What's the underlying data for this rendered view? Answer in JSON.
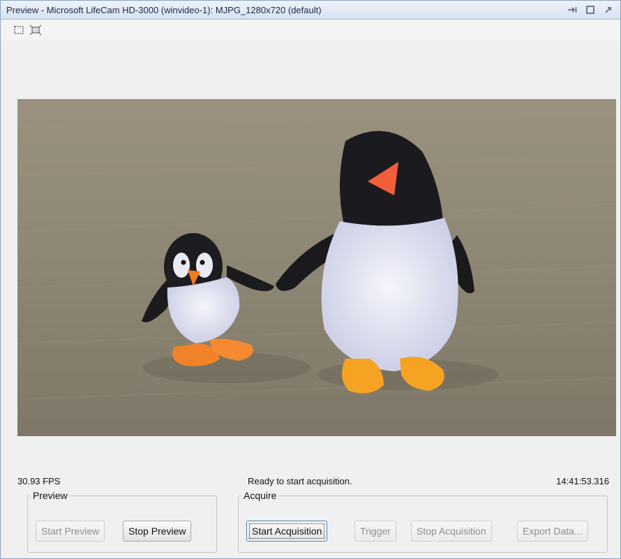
{
  "window": {
    "title": "Preview - Microsoft LifeCam HD-3000 (winvideo-1): MJPG_1280x720 (default)",
    "controls": [
      {
        "name": "dock-icon",
        "glyph": "→│"
      },
      {
        "name": "maximize-icon",
        "glyph": "□"
      },
      {
        "name": "undock-icon",
        "glyph": "↗"
      }
    ]
  },
  "toolbar": {
    "icons": [
      "roi-select-icon",
      "fit-to-window-icon"
    ]
  },
  "status": {
    "fps": "30.93 FPS",
    "message": "Ready to start acquisition.",
    "timestamp": "14:41:53.316"
  },
  "preview_group": {
    "label": "Preview",
    "start_label": "Start Preview",
    "stop_label": "Stop Preview"
  },
  "acquire_group": {
    "label": "Acquire",
    "start_label": "Start Acquisition",
    "trigger_label": "Trigger",
    "stop_label": "Stop Acquisition",
    "export_label": "Export Data..."
  }
}
